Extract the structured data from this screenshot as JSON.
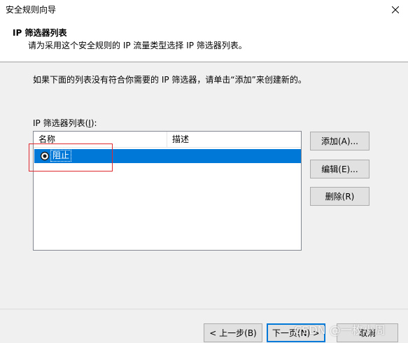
{
  "window": {
    "title": "安全规则向导",
    "close_icon": "close-icon"
  },
  "header": {
    "title": "IP 筛选器列表",
    "subtitle": "请为采用这个安全规则的 IP 流量类型选择 IP 筛选器列表。"
  },
  "body": {
    "intro": "如果下面的列表没有符合你需要的 IP 筛选器，请单击“添加”来创建新的。",
    "list_label_prefix": "IP 筛选器列表(",
    "list_label_key": "I",
    "list_label_suffix": "):"
  },
  "list": {
    "columns": [
      "名称",
      "描述"
    ],
    "rows": [
      {
        "name": "阻止",
        "description": "",
        "selected": true
      }
    ]
  },
  "side_buttons": {
    "add": "添加(A)...",
    "edit": "编辑(E)...",
    "delete": "删除(R)"
  },
  "nav_buttons": {
    "back": "< 上一步(B)",
    "next": "下一页(N) >",
    "cancel": "取消"
  },
  "watermark": "CSDN @一枚小周",
  "colors": {
    "selection": "#0078d7",
    "highlight_box": "#e0282f",
    "window_bg": "#f0f0f0"
  }
}
